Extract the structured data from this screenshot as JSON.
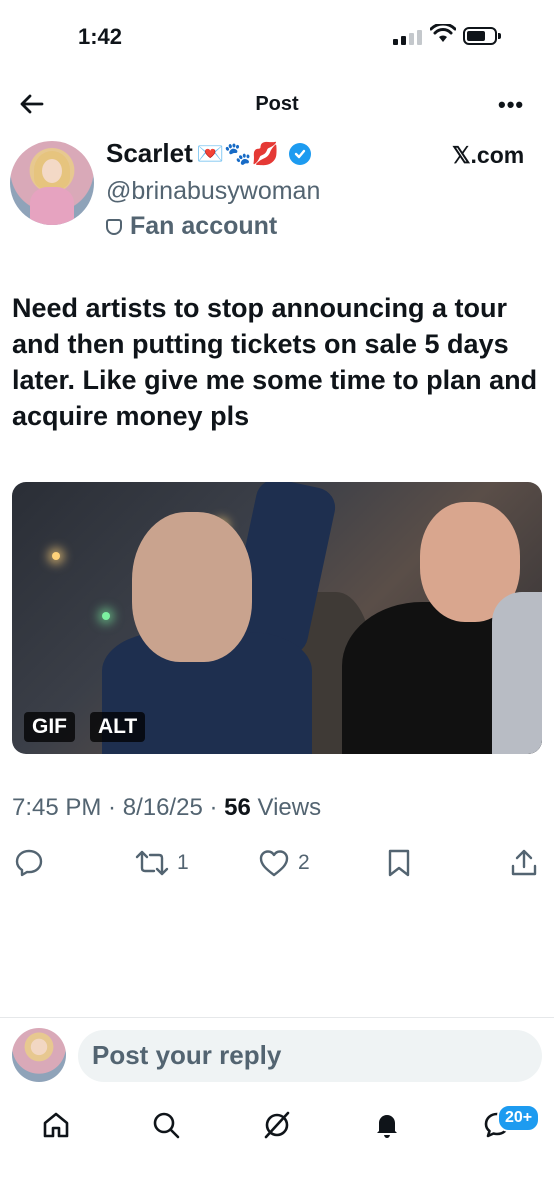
{
  "status_bar": {
    "time": "1:42"
  },
  "header": {
    "title": "Post"
  },
  "author": {
    "name": "Scarlet",
    "emojis": "💌🐾💋",
    "handle": "@brinabusywoman",
    "label": "Fan account",
    "source": "𝕏.com"
  },
  "tweet": {
    "text": "Need artists to stop announcing a tour and then putting tickets on sale 5 days later. Like give me some time to plan and acquire money pls"
  },
  "media": {
    "gif_label": "GIF",
    "alt_label": "ALT"
  },
  "meta": {
    "time": "7:45 PM",
    "date": "8/16/25",
    "views_count": "56",
    "views_label": "Views"
  },
  "actions": {
    "reposts": "1",
    "likes": "2"
  },
  "reply": {
    "placeholder": "Post your reply"
  },
  "tabbar": {
    "messages_badge": "20+"
  },
  "colors": {
    "accent": "#1d9bf0",
    "secondary_text": "#536471",
    "primary_text": "#0f1419"
  }
}
